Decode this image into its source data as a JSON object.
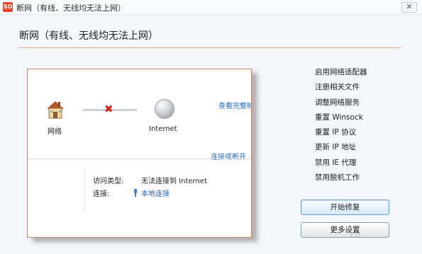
{
  "window": {
    "title": "断网（有线、无线均无法上网）",
    "app_icon_text": "SO",
    "close_symbol": "✕"
  },
  "page": {
    "title": "断网（有线、无线均无法上网）"
  },
  "diagram": {
    "network_label": "网络",
    "internet_label": "Internet",
    "broken_link_symbol": "✖",
    "view_full_map_link": "查看完整映",
    "connect_disconnect_link": "连接或断开",
    "access_type_label": "访问类型:",
    "access_type_value": "无法连接到 Internet",
    "connection_label": "连接:",
    "connection_value": "本地连接"
  },
  "actions": [
    {
      "label": "启用网络适配器"
    },
    {
      "label": "注册相关文件"
    },
    {
      "label": "调整网络服务"
    },
    {
      "label": "重置 Winsock"
    },
    {
      "label": "重置 IP 协议"
    },
    {
      "label": "更新 IP 地址"
    },
    {
      "label": "禁用 IE 代理"
    },
    {
      "label": "禁用脱机工作"
    }
  ],
  "buttons": {
    "start_repair": "开始修复",
    "more_settings": "更多设置"
  },
  "watermark": "cn",
  "colors": {
    "accent_rule": "#e8a288",
    "link": "#1f66c2",
    "error": "#d81e1e",
    "app_icon": "#e5462f"
  }
}
